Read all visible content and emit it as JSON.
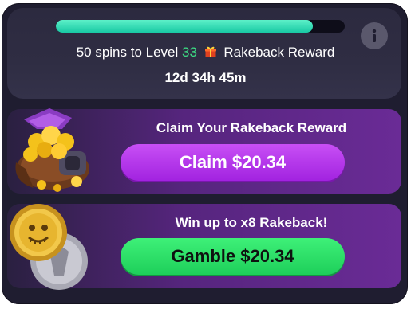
{
  "progress": {
    "fraction": 0.89
  },
  "level_line": {
    "prefix": "50 spins to Level",
    "level": "33",
    "suffix": "Rakeback Reward"
  },
  "timer": "12d 34h 45m",
  "claim_card": {
    "title": "Claim Your Rakeback Reward",
    "button": "Claim $20.34"
  },
  "gamble_card": {
    "title": "Win up to x8 Rakeback!",
    "button": "Gamble $20.34"
  },
  "icons": {
    "info": "info-icon",
    "gift": "gift-icon",
    "bag": "treasure-bag-icon",
    "coin": "coin-flip-icon"
  },
  "colors": {
    "progress": "#19c9a4",
    "level_number": "#3ddc84",
    "claim_button": "#a223e0",
    "gamble_button": "#1ecf5a",
    "card_bg": "#56257e"
  }
}
